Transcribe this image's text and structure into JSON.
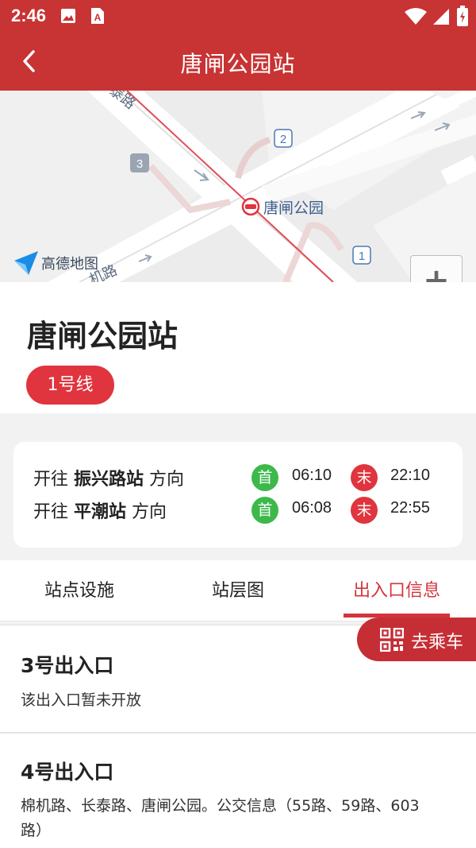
{
  "status_bar": {
    "time": "2:46",
    "icons": [
      "image-icon",
      "font-a-icon",
      "wifi-icon",
      "signal-icon",
      "battery-icon"
    ]
  },
  "header": {
    "title": "唐闸公园站",
    "back_icon": "chevron-left-icon"
  },
  "map": {
    "road_label_1": "泰路",
    "road_label_2": "机路",
    "station_label": "唐闸公园",
    "exit_markers": [
      "2",
      "3",
      "1"
    ],
    "provider_label": "高德地图",
    "zoom_in": "+",
    "zoom_out": "−"
  },
  "station": {
    "name": "唐闸公园站",
    "line": "1号线",
    "line_color": "#e0343e"
  },
  "schedule": {
    "rows": [
      {
        "prefix": "开往",
        "destination": "振兴路站",
        "suffix": "方向",
        "first_label": "首",
        "first_time": "06:10",
        "last_label": "末",
        "last_time": "22:10"
      },
      {
        "prefix": "开往",
        "destination": "平潮站",
        "suffix": "方向",
        "first_label": "首",
        "first_time": "06:08",
        "last_label": "末",
        "last_time": "22:55"
      }
    ]
  },
  "tabs": [
    {
      "label": "站点设施",
      "active": false
    },
    {
      "label": "站层图",
      "active": false
    },
    {
      "label": "出入口信息",
      "active": true
    }
  ],
  "go_button": {
    "label": "去乘车",
    "icon": "qr-code-icon"
  },
  "exits": [
    {
      "title": "3号出入口",
      "description": "该出入口暂未开放"
    },
    {
      "title": "4号出入口",
      "description": "棉机路、长泰路、唐闸公园。公交信息（55路、59路、603路）"
    }
  ],
  "colors": {
    "brand_red": "#c83333",
    "accent_red": "#d4343d",
    "green": "#3cb94a"
  }
}
